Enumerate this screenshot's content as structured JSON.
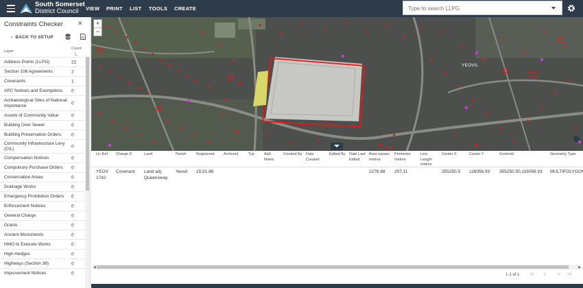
{
  "header": {
    "org_line1": "South Somerset",
    "org_line2": "District Council",
    "nav": [
      "VIEW",
      "PRINT",
      "LIST",
      "TOOLS",
      "CREATE"
    ],
    "search_placeholder": "Type to search LLPG"
  },
  "panel": {
    "title": "Constraints Checker",
    "back_label": "BACK TO SETUP",
    "col_layer": "Layer",
    "col_count": "Count",
    "rows": [
      {
        "layer": "Address Points (LLPG)",
        "count": "22"
      },
      {
        "layer": "Section 106 Agreements",
        "count": "2"
      },
      {
        "layer": "Covenants",
        "count": "1"
      },
      {
        "layer": "APC Notices and Exemptions",
        "count": "0"
      },
      {
        "layer": "Archaeological Sites of National Importance",
        "count": "0"
      },
      {
        "layer": "Assets of Community Value",
        "count": "0"
      },
      {
        "layer": "Building Over Sewer",
        "count": "0"
      },
      {
        "layer": "Building Preservation Orders",
        "count": "0"
      },
      {
        "layer": "Community Infrastructure Levy (CIL)",
        "count": "0"
      },
      {
        "layer": "Compensation Notices",
        "count": "0"
      },
      {
        "layer": "Compulsory Purchase Orders",
        "count": "0"
      },
      {
        "layer": "Conservation Areas",
        "count": "0"
      },
      {
        "layer": "Drainage Works",
        "count": "0"
      },
      {
        "layer": "Emergency Prohibition Orders",
        "count": "0"
      },
      {
        "layer": "Enforcement Notices",
        "count": "0"
      },
      {
        "layer": "General Charge",
        "count": "0"
      },
      {
        "layer": "Grants",
        "count": "0"
      },
      {
        "layer": "Ancient Monuments",
        "count": "0"
      },
      {
        "layer": "HMO to Execute Works",
        "count": "0"
      },
      {
        "layer": "High Hedges",
        "count": "0"
      },
      {
        "layer": "Highways (Section 38)",
        "count": "0"
      },
      {
        "layer": "Improvement Notices",
        "count": "0"
      }
    ]
  },
  "map": {
    "zoom_in": "+",
    "zoom_out": "−",
    "place_label": "YEOVIL"
  },
  "results": {
    "columns": [
      {
        "label": "Llc Ref"
      },
      {
        "label": "Charge D"
      },
      {
        "label": "Land"
      },
      {
        "label": "Parish"
      },
      {
        "label": "Registered"
      },
      {
        "label": "Archived"
      },
      {
        "label": "Typ"
      },
      {
        "label": "Add Notes"
      },
      {
        "label": "Created By"
      },
      {
        "label": "Date Created"
      },
      {
        "label": "Edited By"
      },
      {
        "label": "Date Last Edited"
      },
      {
        "label": "Area square metres"
      },
      {
        "label": "Perimeter metres"
      },
      {
        "label": "Line Length metres"
      },
      {
        "label": "Center X"
      },
      {
        "label": "Center Y"
      },
      {
        "label": "Centroid"
      },
      {
        "label": "Geometry Type"
      }
    ],
    "row": [
      "YEOV 1742",
      "Covenant",
      "Land adj. Queensway",
      "Yeovil",
      "15.01.86",
      "",
      "",
      "",
      "",
      "",
      "",
      "",
      "1276.88",
      "207.11",
      "",
      "355250.5",
      "116056.93",
      "355250.50,116056.93",
      "MULTIPOLYGON"
    ],
    "pager_text": "1-1 of 1",
    "pager_icons": [
      "|<",
      "<",
      ">",
      ">|"
    ]
  }
}
